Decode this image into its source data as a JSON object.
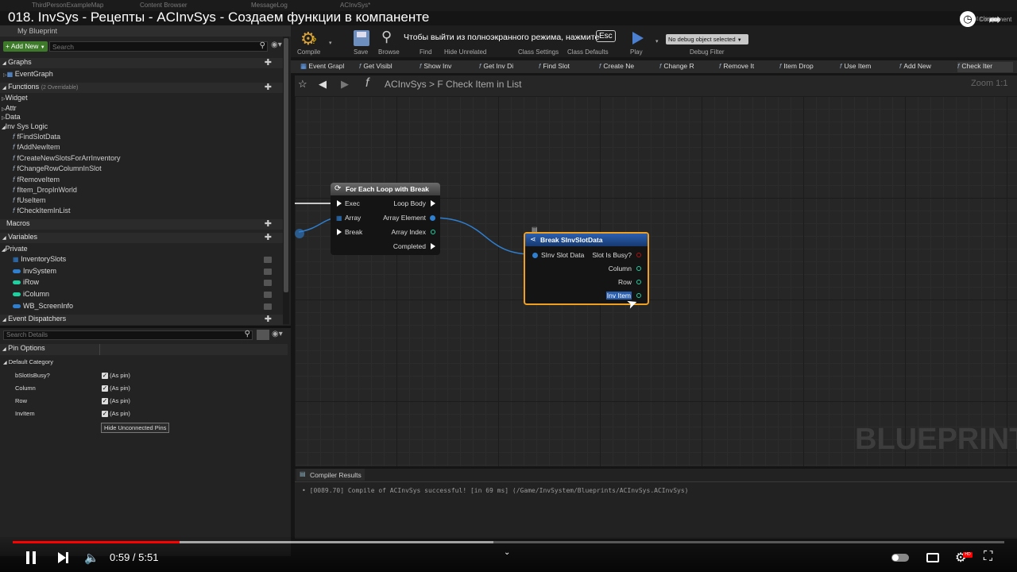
{
  "editor_tabs": [
    "ThirdPersonExampleMap",
    "Content Browser",
    "MessageLog",
    "ACInvSys*"
  ],
  "video_title": "018. InvSys - Рецепты - ACInvSys - Создаем функции в компаненте",
  "parent_class_label": "Parent class:",
  "component_label": "Component",
  "my_blueprint": {
    "title": "My Blueprint",
    "add_new": "Add New",
    "search_placeholder": "Search",
    "graphs_label": "Graphs",
    "event_graph": "EventGraph",
    "functions_label": "Functions",
    "functions_overridable": "(2 Overridable)",
    "categories": [
      "Widget",
      "Attr",
      "Data"
    ],
    "logic_category": "Inv Sys Logic",
    "functions": [
      "fFindSlotData",
      "fAddNewItem",
      "fCreateNewSlotsForArrInventory",
      "fChangeRowColumnInSlot",
      "fRemoveItem",
      "fItem_DropInWorld",
      "fUseItem",
      "fCheckItemInList"
    ],
    "macros_label": "Macros",
    "variables_label": "Variables",
    "private_label": "Private",
    "variables": [
      {
        "name": "InventorySlots",
        "color": "#2f7fd0"
      },
      {
        "name": "InvSystem",
        "color": "#2f7fd0"
      },
      {
        "name": "iRow",
        "color": "#1fd1a1"
      },
      {
        "name": "iColumn",
        "color": "#1fd1a1"
      },
      {
        "name": "WB_ScreenInfo",
        "color": "#2f7fd0"
      }
    ],
    "event_dispatchers_label": "Event Dispatchers"
  },
  "details": {
    "search_placeholder": "Search Details",
    "pin_options": "Pin Options",
    "default_category": "Default Category",
    "pins": [
      {
        "name": "bSlotIsBusy?",
        "value": "(As pin)"
      },
      {
        "name": "Column",
        "value": "(As pin)"
      },
      {
        "name": "Row",
        "value": "(As pin)"
      },
      {
        "name": "InvItem",
        "value": "(As pin)"
      }
    ],
    "hide_button": "Hide Unconnected Pins"
  },
  "toolbar": {
    "compile": "Compile",
    "save": "Save",
    "browse": "Browse",
    "find": "Find",
    "hide_unrelated": "Hide Unrelated",
    "class_settings": "Class Settings",
    "class_defaults": "Class Defaults",
    "play": "Play",
    "debug_dropdown": "No debug object selected",
    "debug_filter": "Debug Filter",
    "fullscreen_hint": "Чтобы выйти из полноэкранного режима, нажмите",
    "esc_key": "Esc"
  },
  "function_tabs": [
    "Event Grapl",
    "Get Visibl",
    "Show Inv",
    "Get Inv Di",
    "Find Slot",
    "Create Ne",
    "Change R",
    "Remove It",
    "Item Drop",
    "Use Item",
    "Add New",
    "Check Iter"
  ],
  "breadcrumb": {
    "root": "ACInvSys",
    "separator": ">",
    "current": "F Check Item in List"
  },
  "zoom": "Zoom 1:1",
  "watermark": "BLUEPRINT",
  "foreach_node": {
    "title": "For Each Loop with Break",
    "inputs": [
      "Exec",
      "Array",
      "Break"
    ],
    "outputs": [
      "Loop Body",
      "Array Element",
      "Array Index",
      "Completed"
    ]
  },
  "break_node": {
    "title": "Break SInvSlotData",
    "input": "SInv Slot Data",
    "outputs": [
      "Slot Is Busy?",
      "Column",
      "Row",
      "Inv Item"
    ]
  },
  "compiler": {
    "tab": "Compiler Results",
    "message": "[0089.70] Compile of ACInvSys successful! [in 69 ms] (/Game/InvSystem/Blueprints/ACInvSys.ACInvSys)"
  },
  "video": {
    "time": "0:59 / 5:51",
    "progress": 0.168,
    "buffered": 0.485,
    "accent": "#ff0000"
  }
}
